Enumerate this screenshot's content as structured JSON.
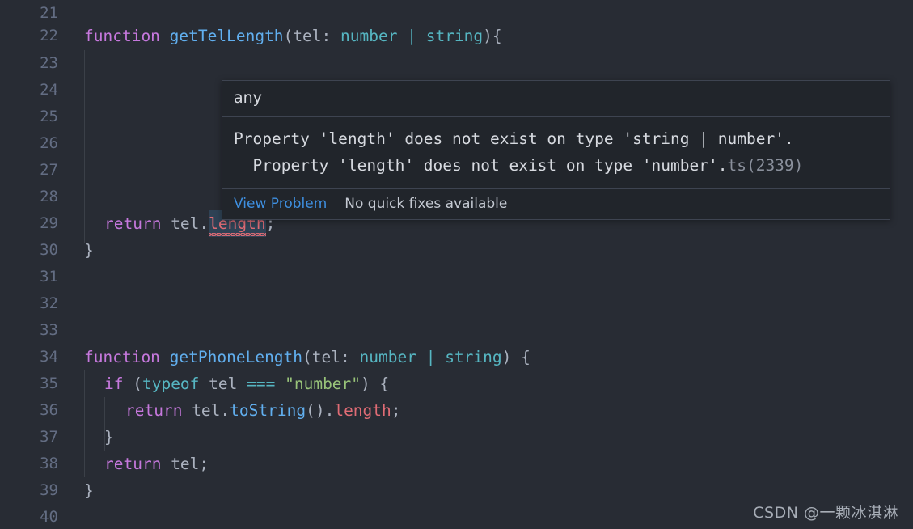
{
  "editor": {
    "language": "typescript",
    "theme": "One Dark Pro",
    "background_color": "#282c34",
    "line_number_color": "#636d83",
    "first_visible_line": 21,
    "last_visible_line": 40,
    "lines": [
      {
        "number": "21",
        "text": ""
      },
      {
        "number": "22",
        "text": "function getTelLength(tel: number | string){"
      },
      {
        "number": "23",
        "text": ""
      },
      {
        "number": "24",
        "text": ""
      },
      {
        "number": "25",
        "text": ""
      },
      {
        "number": "26",
        "text": ""
      },
      {
        "number": "27",
        "text": ""
      },
      {
        "number": "28",
        "text": ""
      },
      {
        "number": "29",
        "text": "  return tel.length;"
      },
      {
        "number": "30",
        "text": "}"
      },
      {
        "number": "31",
        "text": ""
      },
      {
        "number": "32",
        "text": ""
      },
      {
        "number": "33",
        "text": ""
      },
      {
        "number": "34",
        "text": "function getPhoneLength(tel: number | string) {"
      },
      {
        "number": "35",
        "text": "  if (typeof tel === \"number\") {"
      },
      {
        "number": "36",
        "text": "    return tel.toString().length;"
      },
      {
        "number": "37",
        "text": "  }"
      },
      {
        "number": "38",
        "text": "  return tel;"
      },
      {
        "number": "39",
        "text": "}"
      },
      {
        "number": "40",
        "text": ""
      }
    ],
    "tokens": {
      "line22": {
        "keyword": "function",
        "name": "getTelLength",
        "open_paren": "(",
        "param": "tel",
        "colon": ": ",
        "type_a": "number",
        "union": " | ",
        "type_b": "string",
        "close": "){"
      },
      "line29": {
        "keyword": "return",
        "object": " tel",
        "dot": ".",
        "property": "length",
        "semicolon": ";"
      },
      "line30": {
        "brace": "}"
      },
      "line34": {
        "keyword": "function",
        "name": "getPhoneLength",
        "open_paren": "(",
        "param": "tel",
        "colon": ": ",
        "type_a": "number",
        "union": " | ",
        "type_b": "string",
        "close": ") {"
      },
      "line35": {
        "keyword": "if",
        "open_paren": " (",
        "operator_typeof": "typeof",
        "object": " tel ",
        "operator_eq": "===",
        "space": " ",
        "string": "\"number\"",
        "close": ") {"
      },
      "line36": {
        "keyword": "return",
        "object": " tel",
        "dot1": ".",
        "method": "toString",
        "parens": "()",
        "dot2": ".",
        "property": "length",
        "semicolon": ";"
      },
      "line37": {
        "brace": "}"
      },
      "line38": {
        "keyword": "return",
        "object": " tel",
        "semicolon": ";"
      },
      "line39": {
        "brace": "}"
      }
    },
    "colors": {
      "keyword": "#c678dd",
      "function_name": "#61afef",
      "type": "#56b6c2",
      "operator": "#56b6c2",
      "string": "#98c379",
      "property_error": "#e06c75",
      "punctuation": "#abb2bf",
      "variable": "#abb2bf",
      "selection": "#2f4255",
      "error_squiggle": "#e06c75"
    }
  },
  "hover_tooltip": {
    "type_signature": "any",
    "diagnostic_line_1": "Property 'length' does not exist on type 'string | number'.",
    "diagnostic_line_2": "  Property 'length' does not exist on type 'number'.",
    "error_code": "ts(2339)",
    "view_problem_label": "View Problem",
    "quick_fix_label": "No quick fixes available",
    "background_color": "#21252b",
    "border_color": "#3e4451",
    "link_color": "#3e8fe0"
  },
  "watermark": {
    "text": "CSDN @一颗冰淇淋"
  }
}
